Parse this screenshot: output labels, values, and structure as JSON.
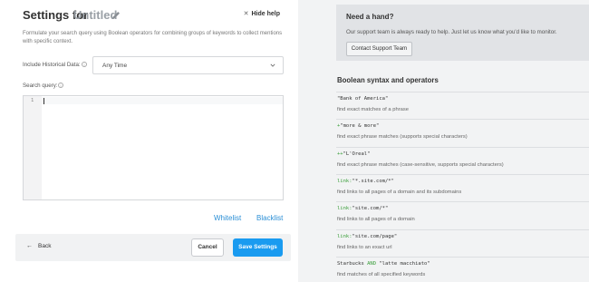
{
  "header": {
    "title": "Settings for",
    "name": "Untitled",
    "hide_help": "Hide help"
  },
  "description": "Formulate your search query using Boolean operators for combining groups of keywords to collect mentions with specific context.",
  "historical": {
    "label": "Include Historical Data:",
    "value": "Any Time"
  },
  "query": {
    "label": "Search query:",
    "line_number": "1"
  },
  "links": {
    "whitelist": "Whitelist",
    "blacklist": "Blacklist"
  },
  "footer": {
    "back": "Back",
    "cancel": "Cancel",
    "save": "Save Settings"
  },
  "help": {
    "title": "Need a hand?",
    "text": "Our support team is always ready to help. Just let us know what you'd like to monitor.",
    "button": "Contact Support Team"
  },
  "syntax": {
    "title": "Boolean syntax and operators",
    "examples": [
      {
        "prefix": "",
        "code": "\"Bank of America\"",
        "suffix": "",
        "desc": "find exact matches of a phrase"
      },
      {
        "prefix": "+",
        "code": "\"more & more\"",
        "suffix": "",
        "desc": "find exact phrase matches (supports special characters)"
      },
      {
        "prefix": "++",
        "code": "\"L'Oreal\"",
        "suffix": "",
        "desc": "find exact phrase matches (case-sensitive, supports special characters)"
      },
      {
        "prefix": "link:",
        "code": "\"*.site.com/*\"",
        "suffix": "",
        "desc": "find links to all pages of a domain and its subdomains"
      },
      {
        "prefix": "link:",
        "code": "\"site.com/*\"",
        "suffix": "",
        "desc": "find links to all pages of a domain"
      },
      {
        "prefix": "link:",
        "code": "\"site.com/page\"",
        "suffix": "",
        "desc": "find links to an exact url"
      },
      {
        "prefix": "Starbucks ",
        "code": "AND",
        "suffix": " \"latte macchiato\"",
        "desc": "find matches of all specified keywords"
      }
    ]
  },
  "colors": {
    "accent": "#1a9bf0",
    "link": "#2b8fd6",
    "operator": "#3a9e3a"
  }
}
